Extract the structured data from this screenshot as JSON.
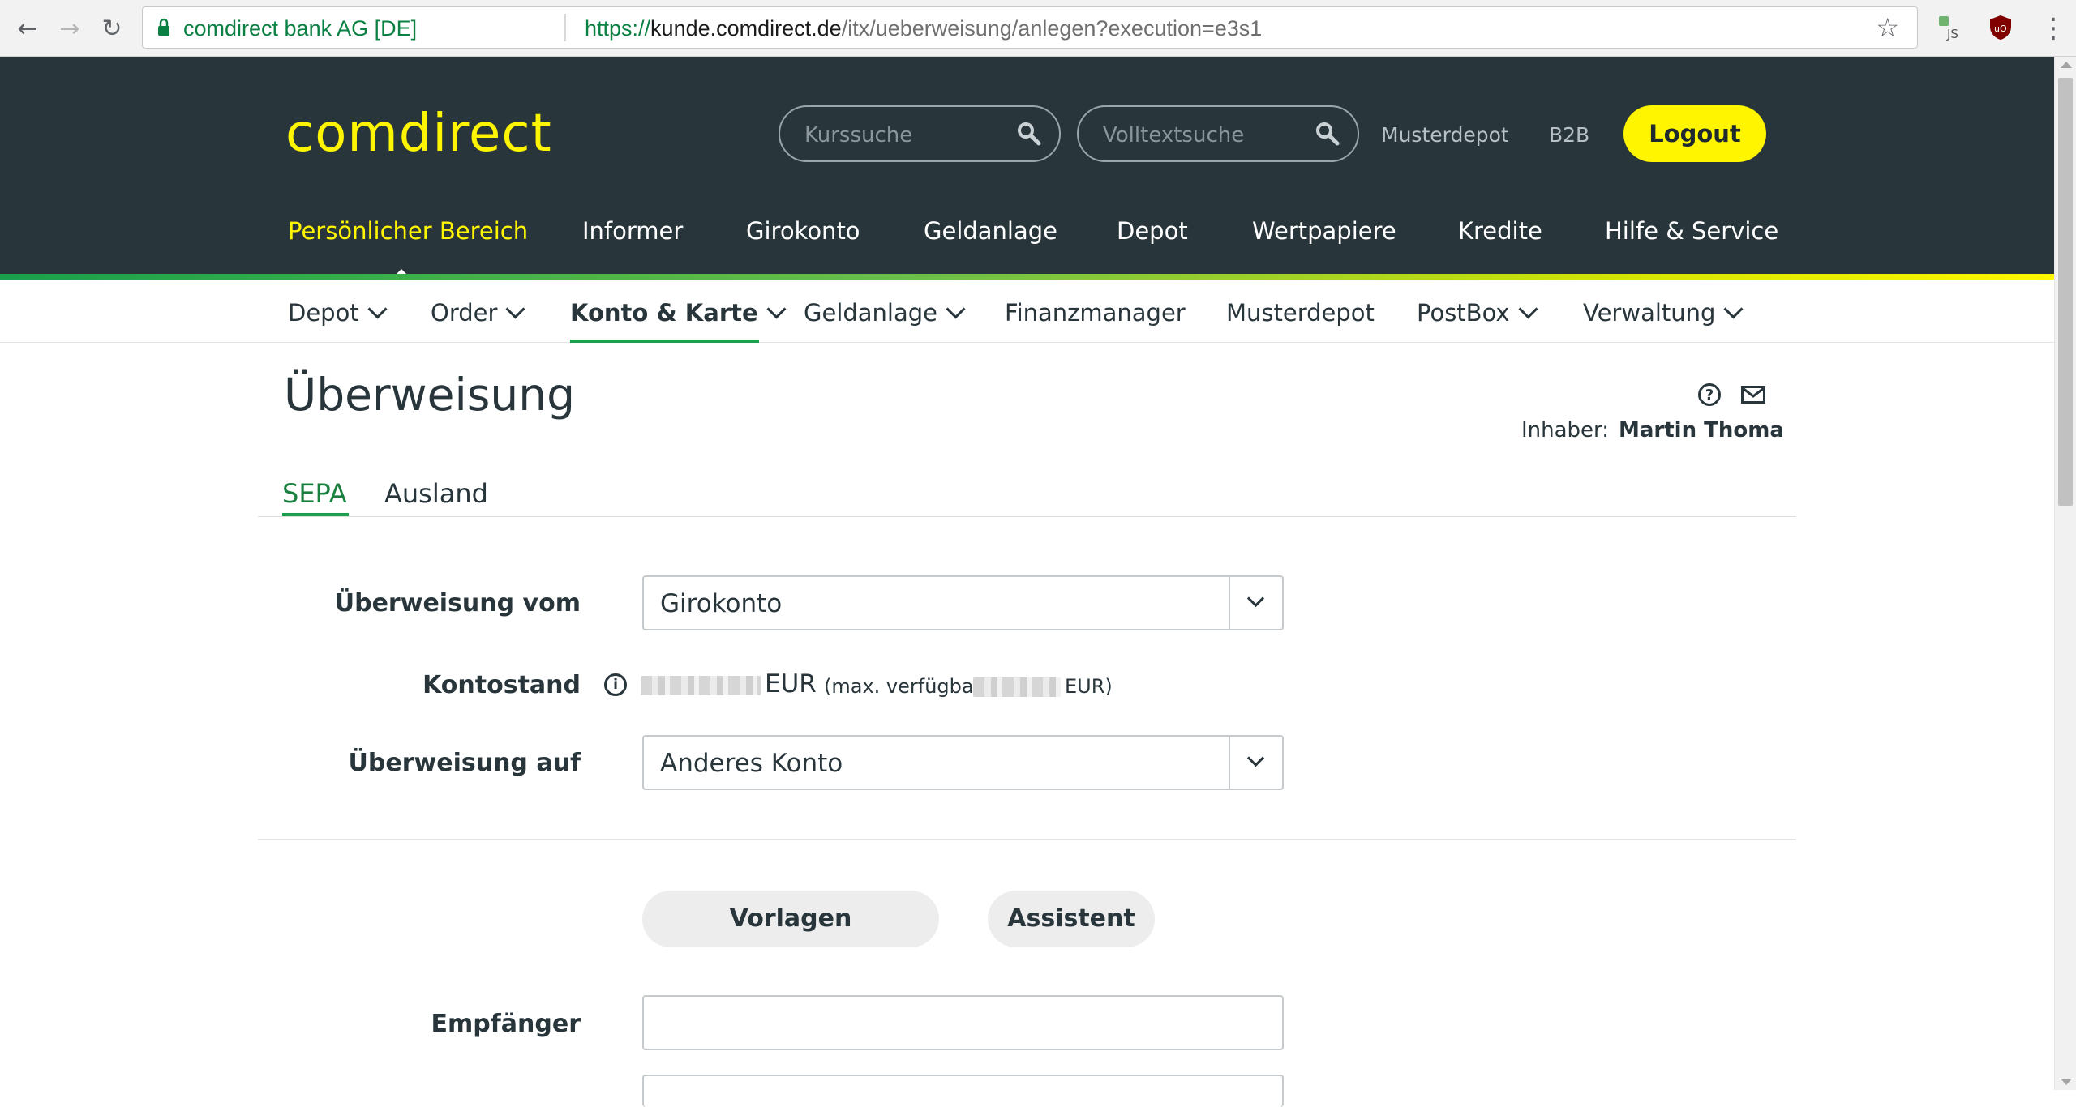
{
  "browser": {
    "site_name": "comdirect bank AG [DE]",
    "url_scheme": "https://",
    "url_host": "kunde.comdirect.de",
    "url_path": "/itx/ueberweisung/anlegen?execution=e3s1",
    "extension_js_label": "JS",
    "extension_ublock_label": "uO"
  },
  "header": {
    "logo": "comdirect",
    "search1_placeholder": "Kurssuche",
    "search2_placeholder": "Volltextsuche",
    "link_musterdepot": "Musterdepot",
    "link_b2b": "B2B",
    "logout": "Logout",
    "main_nav": [
      "Persönlicher Bereich",
      "Informer",
      "Girokonto",
      "Geldanlage",
      "Depot",
      "Wertpapiere",
      "Kredite",
      "Hilfe & Service"
    ],
    "active_main_nav": "Persönlicher Bereich"
  },
  "subnav": {
    "items": [
      "Depot",
      "Order",
      "Konto & Karte",
      "Geldanlage",
      "Finanzmanager",
      "Musterdepot",
      "PostBox",
      "Verwaltung"
    ],
    "active": "Konto & Karte"
  },
  "page": {
    "title": "Überweisung",
    "owner_label": "Inhaber:",
    "owner_name": "Martin Thoma",
    "tabs": [
      "SEPA",
      "Ausland"
    ],
    "active_tab": "SEPA"
  },
  "form": {
    "from_label": "Überweisung vom",
    "from_value": "Girokonto",
    "balance_label": "Kontostand",
    "balance_currency": "EUR",
    "balance_note": "(max. verfügbar",
    "balance_note_currency": "EUR)",
    "to_label": "Überweisung auf",
    "to_value": "Anderes Konto",
    "button_templates": "Vorlagen",
    "button_assistant": "Assistent",
    "recipient_label": "Empfänger",
    "recipient_value": ""
  },
  "colors": {
    "header_bg": "#28353b",
    "brand_yellow": "#fff500",
    "accent_green": "#19a04a"
  }
}
